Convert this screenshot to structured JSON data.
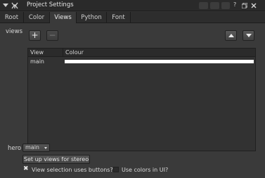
{
  "window": {
    "title": "Project Settings"
  },
  "titlebar_icons": [
    "collapse-arrow-icon",
    "node-settings-icon",
    "lock-icon",
    "float-icon",
    "copy-icon",
    "help-icon",
    "pin-icon",
    "close-icon"
  ],
  "tabs": [
    {
      "label": "Root"
    },
    {
      "label": "Color"
    },
    {
      "label": "Views"
    },
    {
      "label": "Python"
    },
    {
      "label": "Font"
    }
  ],
  "active_tab": "Views",
  "views_section": {
    "label": "views",
    "add_glyph": "+",
    "remove_glyph": "−",
    "table": {
      "columns": [
        "View",
        "Colour"
      ],
      "rows": [
        {
          "view": "main",
          "colour": "#ffffff"
        }
      ]
    }
  },
  "hero": {
    "label": "hero",
    "value": "main"
  },
  "stereo_button": {
    "label": "Set up views for stereo"
  },
  "checkboxes": [
    {
      "label": "View selection uses buttons?",
      "checked": true,
      "mark": "✖"
    },
    {
      "label": "Use colors in UI?",
      "checked": false
    }
  ]
}
